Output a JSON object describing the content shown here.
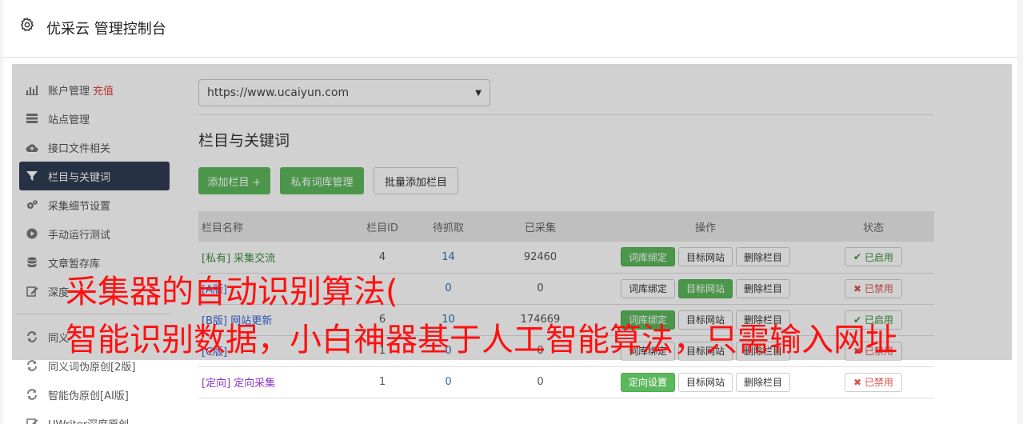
{
  "header": {
    "title": "优采云 管理控制台",
    "icon": "gear-icon"
  },
  "sidebar": {
    "items": [
      {
        "label": "账户管理",
        "badge": "充值",
        "icon": "bar-chart-icon"
      },
      {
        "label": "站点管理",
        "icon": "server-icon"
      },
      {
        "label": "接口文件相关",
        "icon": "cloud-upload-icon"
      },
      {
        "label": "栏目与关键词",
        "icon": "filter-icon",
        "active": true
      },
      {
        "label": "采集细节设置",
        "icon": "cogs-icon"
      },
      {
        "label": "手动运行测试",
        "icon": "play-circle-icon"
      },
      {
        "label": "文章暂存库",
        "icon": "database-icon"
      },
      {
        "label": "深度",
        "icon": "edit-icon"
      },
      {
        "label": "同义",
        "icon": "refresh-icon"
      },
      {
        "label": "同义词伪原创[2版]",
        "icon": "refresh-icon"
      },
      {
        "label": "智能伪原创[AI版]",
        "icon": "refresh-icon"
      },
      {
        "label": "UWriter深度原创",
        "icon": "edit-icon"
      }
    ]
  },
  "site_select": {
    "value": "https://www.ucaiyun.com"
  },
  "section_title": "栏目与关键词",
  "buttons": {
    "add": "添加栏目 +",
    "private_lib": "私有词库管理",
    "batch_add": "批量添加栏目"
  },
  "table": {
    "headers": [
      "栏目名称",
      "栏目ID",
      "待抓取",
      "已采集",
      "操作",
      "状态"
    ],
    "rows": [
      {
        "tag": "[私有]",
        "name": "采集交流",
        "id": "4",
        "pending": "14",
        "collected": "92460",
        "op1": "词库绑定",
        "op2": "目标网站",
        "op3": "删除栏目",
        "status": "已启用"
      },
      {
        "tag": "[A版]",
        "name": "",
        "id": "",
        "pending": "0",
        "collected": "0",
        "op1": "词库绑定",
        "op2": "目标网站",
        "op3": "删除栏目",
        "status": "已禁用"
      },
      {
        "tag": "[B版]",
        "name": "网站更新",
        "id": "6",
        "pending": "10",
        "collected": "174669",
        "op1": "词库绑定",
        "op2": "目标网站",
        "op3": "删除栏目",
        "status": "已启用"
      },
      {
        "tag": "[C版]",
        "name": "",
        "id": "1",
        "pending": "0",
        "collected": "0",
        "op1": "词库绑定",
        "op2": "目标网站",
        "op3": "删除栏目",
        "status": "已禁用"
      },
      {
        "tag": "[定向]",
        "name": "定向采集",
        "id": "1",
        "pending": "0",
        "collected": "0",
        "op1": "定向设置",
        "op2": "目标网站",
        "op3": "删除栏目",
        "status": "已禁用"
      }
    ]
  },
  "caption": {
    "line1": "采集器的自动识别算法(",
    "line2": "智能识别数据，小白神器基于人工智能算法，只需输入网址"
  }
}
